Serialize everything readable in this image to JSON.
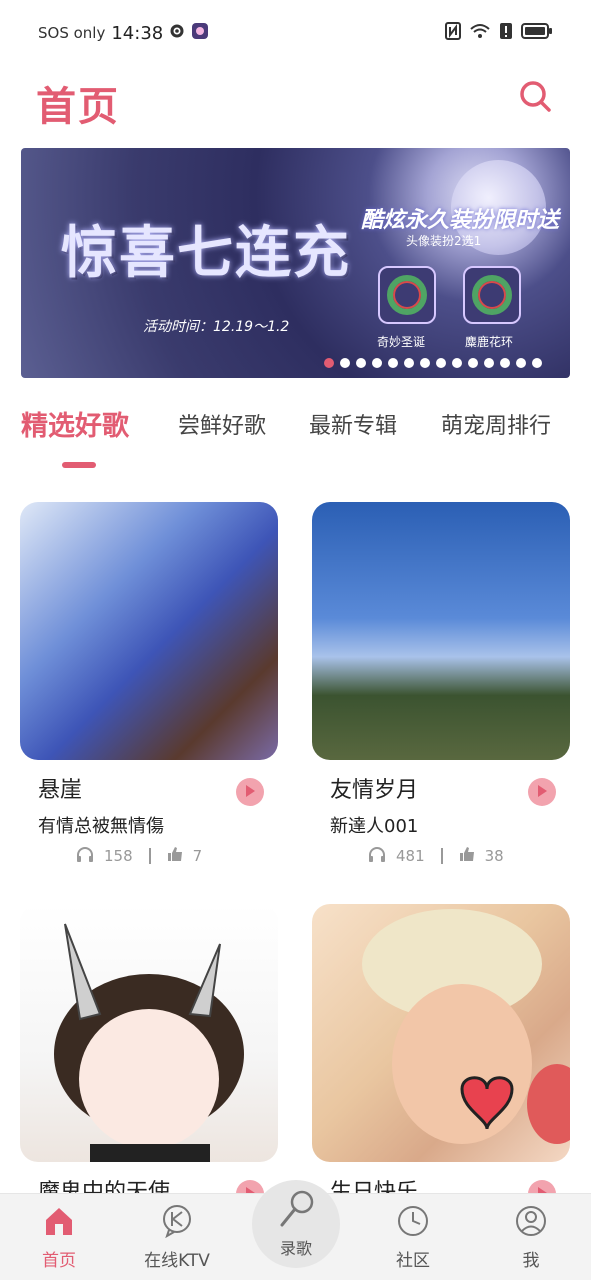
{
  "status_bar": {
    "carrier": "SOS only",
    "time": "14:38",
    "icons": [
      "gear-icon",
      "app-notification-icon",
      "nfc-icon",
      "wifi-icon",
      "alert-icon",
      "battery-icon"
    ]
  },
  "header": {
    "title": "首页",
    "search_icon": "search-icon"
  },
  "banner": {
    "headline": "惊喜七连充",
    "subtitle": "酷炫永久装扮限时送",
    "small_text": "头像装扮2选1",
    "date_text": "活动时间：12.19～1.2",
    "badge_1_label": "奇妙圣诞",
    "badge_2_label": "麋鹿花环",
    "active_dot_index": 0,
    "dot_count": 14
  },
  "tabs": [
    {
      "label": "精选好歌",
      "active": true
    },
    {
      "label": "尝鲜好歌",
      "active": false
    },
    {
      "label": "最新专辑",
      "active": false
    },
    {
      "label": "萌宠周排行",
      "active": false
    }
  ],
  "songs": [
    {
      "title": "悬崖",
      "user": "有情总被無情傷",
      "listens": "158",
      "likes": "7"
    },
    {
      "title": "友情岁月",
      "user": "新達人001",
      "listens": "481",
      "likes": "38"
    },
    {
      "title": "魔鬼中的天使",
      "user": "",
      "listens": "",
      "likes": ""
    },
    {
      "title": "生日快乐",
      "user": "",
      "listens": "",
      "likes": ""
    }
  ],
  "bottom_nav": [
    {
      "label": "首页",
      "icon": "home-icon",
      "active": true
    },
    {
      "label": "在线KTV",
      "icon": "ktv-icon",
      "active": false
    },
    {
      "label": "录歌",
      "icon": "microphone-icon",
      "active": false
    },
    {
      "label": "社区",
      "icon": "clock-icon",
      "active": false
    },
    {
      "label": "我",
      "icon": "user-icon",
      "active": false
    }
  ],
  "colors": {
    "accent": "#e25c72",
    "play_button": "#f2a3ae",
    "nav_background": "#f3f3f3"
  }
}
